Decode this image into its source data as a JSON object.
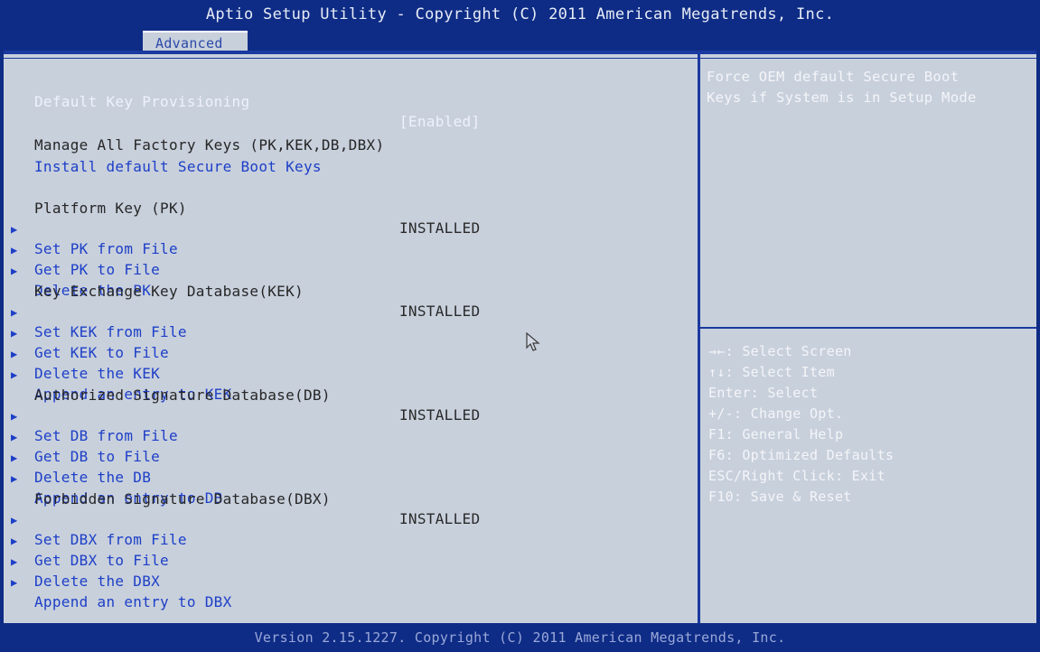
{
  "header": {
    "title": "Aptio Setup Utility - Copyright (C) 2011 American Megatrends, Inc.",
    "active_tab": "Advanced"
  },
  "menu": {
    "default_key_provisioning": {
      "label": "Default Key Provisioning",
      "value": "[Enabled]"
    },
    "manage_factory_keys": "Manage All Factory Keys (PK,KEK,DB,DBX)",
    "install_default_keys": "Install default Secure Boot Keys",
    "platform_key": {
      "label": "Platform Key (PK)",
      "value": "INSTALLED"
    },
    "set_pk": "Set PK from File",
    "get_pk": "Get PK to File",
    "delete_pk": "Delete the PK",
    "kek": {
      "label": "Key Exchange Key Database(KEK)",
      "value": "INSTALLED"
    },
    "set_kek": "Set KEK from File",
    "get_kek": "Get KEK to File",
    "delete_kek": "Delete the KEK",
    "append_kek": "Append an entry to KEK",
    "db": {
      "label": "Authorized Signature Database(DB)",
      "value": "INSTALLED"
    },
    "set_db": "Set DB from File",
    "get_db": "Get DB to File",
    "delete_db": "Delete the DB",
    "append_db": "Append an entry to DB",
    "dbx": {
      "label": "Forbidden Signature Database(DBX)",
      "value": "INSTALLED"
    },
    "set_dbx": "Set DBX from File",
    "get_dbx": "Get DBX to File",
    "delete_dbx": "Delete the DBX",
    "append_dbx": "Append an entry to DBX"
  },
  "help": {
    "line1": "Force OEM default Secure Boot",
    "line2": "Keys if System is in Setup Mode"
  },
  "keys": {
    "select_screen": "→←: Select Screen",
    "select_item": "↑↓: Select Item",
    "enter": "Enter: Select",
    "change": "+/-: Change Opt.",
    "f1": "F1: General Help",
    "f6": "F6: Optimized Defaults",
    "esc": "ESC/Right Click: Exit",
    "f10": "F10: Save & Reset"
  },
  "footer": {
    "version": "Version 2.15.1227. Copyright (C) 2011 American Megatrends, Inc."
  },
  "colors": {
    "background": "#0e2c86",
    "panel": "#c8d0dc",
    "link_blue": "#1d3fc7",
    "highlight": "#eef2fb"
  }
}
